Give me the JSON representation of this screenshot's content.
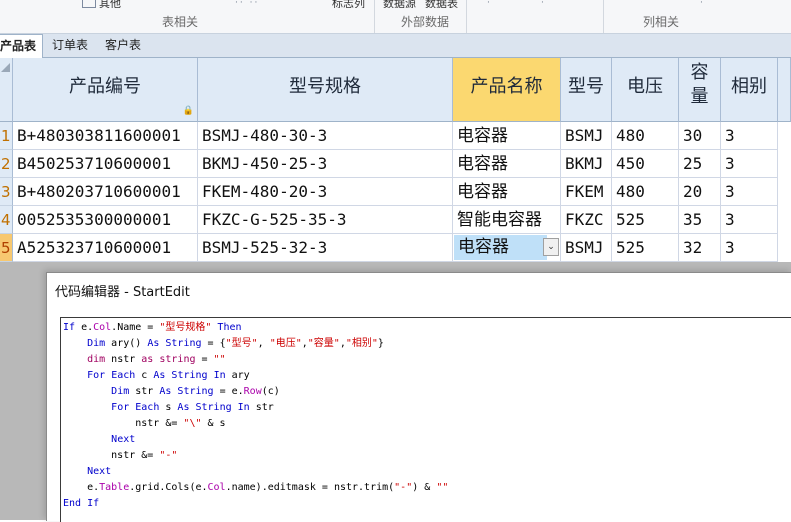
{
  "ribbon": {
    "top_items": [
      "其他",
      "标志列",
      "数据源",
      "数据表"
    ],
    "groups": [
      "表相关",
      "外部数据",
      "列相关"
    ]
  },
  "tabs": [
    "产品表",
    "订单表",
    "客户表"
  ],
  "grid": {
    "headers": [
      "产品编号",
      "型号规格",
      "产品名称",
      "型号",
      "电压",
      "容量",
      "相别"
    ],
    "rows": [
      {
        "num": "1",
        "cells": [
          "B+480303811600001",
          "BSMJ-480-30-3",
          "电容器",
          "BSMJ",
          "480",
          "30",
          "3"
        ]
      },
      {
        "num": "2",
        "cells": [
          "B450253710600001",
          "BKMJ-450-25-3",
          "电容器",
          "BKMJ",
          "450",
          "25",
          "3"
        ]
      },
      {
        "num": "3",
        "cells": [
          "B+480203710600001",
          "FKEM-480-20-3",
          "电容器",
          "FKEM",
          "480",
          "20",
          "3"
        ]
      },
      {
        "num": "4",
        "cells": [
          "0052535300000001",
          "FKZC-G-525-35-3",
          "智能电容器",
          "FKZC",
          "525",
          "35",
          "3"
        ]
      },
      {
        "num": "5",
        "cells": [
          "A525323710600001",
          "BSMJ-525-32-3",
          "电容器",
          "BSMJ",
          "525",
          "32",
          "3"
        ]
      }
    ],
    "dropdown_glyph": "⌄"
  },
  "editor": {
    "title": "代码编辑器 - StartEdit",
    "code_lines": [
      "If e.Col.Name = \"型号规格\" Then",
      "    Dim ary() As String = {\"型号\", \"电压\",\"容量\",\"相别\"}",
      "    dim nstr as string = \"\"",
      "    For Each c As String In ary",
      "        Dim str As String = e.Row(c)",
      "        For Each s As String In str",
      "            nstr &= \"\\\" & s",
      "        Next",
      "        nstr &= \"-\"",
      "    Next",
      "    e.Table.grid.Cols(e.Col.name).editmask = nstr.trim(\"-\") & \"\"",
      "End If"
    ]
  },
  "colors": {
    "header_bg": "#dfeaf6",
    "selected_header": "#fbd870",
    "edit_cell": "#bfe0f8",
    "keyword": "#0000cc",
    "string": "#cc0000"
  }
}
